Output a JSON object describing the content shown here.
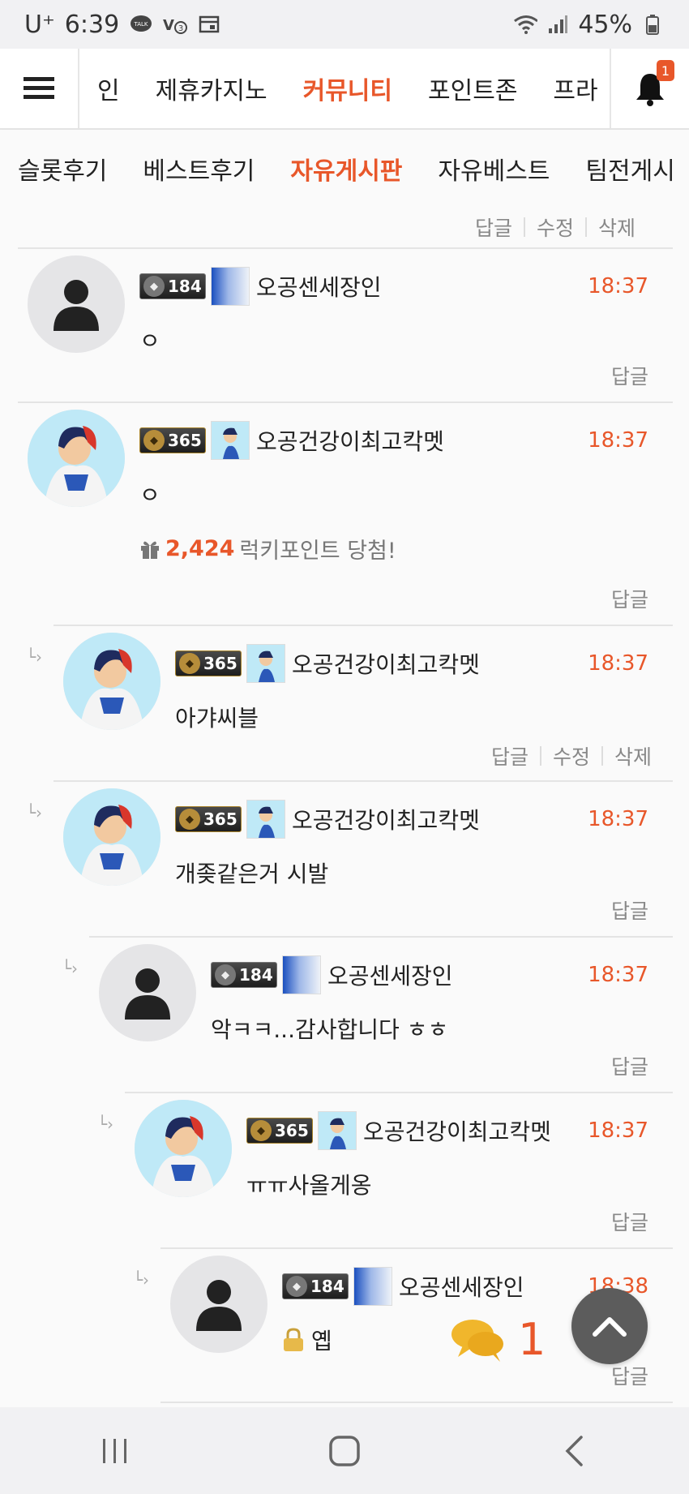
{
  "status_bar": {
    "carrier": "U⁺",
    "time": "6:39",
    "battery": "45%",
    "icons": [
      "talk-icon",
      "volte-icon",
      "calendar-icon",
      "wifi-icon",
      "signal-icon",
      "battery-icon"
    ]
  },
  "top_nav": {
    "items": [
      "인",
      "제휴카지노",
      "커뮤니티",
      "포인트존",
      "프라"
    ],
    "active": "커뮤니티",
    "notification_count": "1"
  },
  "sub_nav": {
    "items": [
      "슬롯후기",
      "베스트후기",
      "자유게시판",
      "자유베스트",
      "팀전게시"
    ],
    "active": "자유게시판"
  },
  "top_actions": {
    "reply": "답글",
    "edit": "수정",
    "delete": "삭제"
  },
  "comments": [
    {
      "level": "184",
      "nickname": "오공센세장인",
      "time": "18:37",
      "text": "ㅇ",
      "reply": "답글",
      "avatar": "default",
      "depth": 0
    },
    {
      "level": "365",
      "nickname": "오공건강이최고칵멧",
      "time": "18:37",
      "text": "ㅇ",
      "reply": "답글",
      "avatar": "character",
      "depth": 0,
      "lucky_points": "2,424",
      "lucky_text": "럭키포인트 당첨!"
    },
    {
      "level": "365",
      "nickname": "오공건강이최고칵멧",
      "time": "18:37",
      "text": "아갸씨블",
      "reply": "답글",
      "edit": "수정",
      "delete": "삭제",
      "avatar": "character",
      "depth": 1
    },
    {
      "level": "365",
      "nickname": "오공건강이최고칵멧",
      "time": "18:37",
      "text": "개좆같은거 시발",
      "reply": "답글",
      "avatar": "character",
      "depth": 1
    },
    {
      "level": "184",
      "nickname": "오공센세장인",
      "time": "18:37",
      "text": "악ㅋㅋ...감사합니다 ㅎㅎ",
      "reply": "답글",
      "avatar": "default",
      "depth": 2
    },
    {
      "level": "365",
      "nickname": "오공건강이최고칵멧",
      "time": "18:37",
      "text": "ㅠㅠ사올게옹",
      "reply": "답글",
      "avatar": "character",
      "depth": 3
    },
    {
      "level": "184",
      "nickname": "오공센세장인",
      "time": "18:38",
      "text": "옙",
      "reply": "답글",
      "avatar": "default",
      "depth": 4,
      "locked": true
    }
  ],
  "floating": {
    "comment_count": "1"
  },
  "colors": {
    "accent": "#e8572a",
    "muted": "#888888"
  }
}
